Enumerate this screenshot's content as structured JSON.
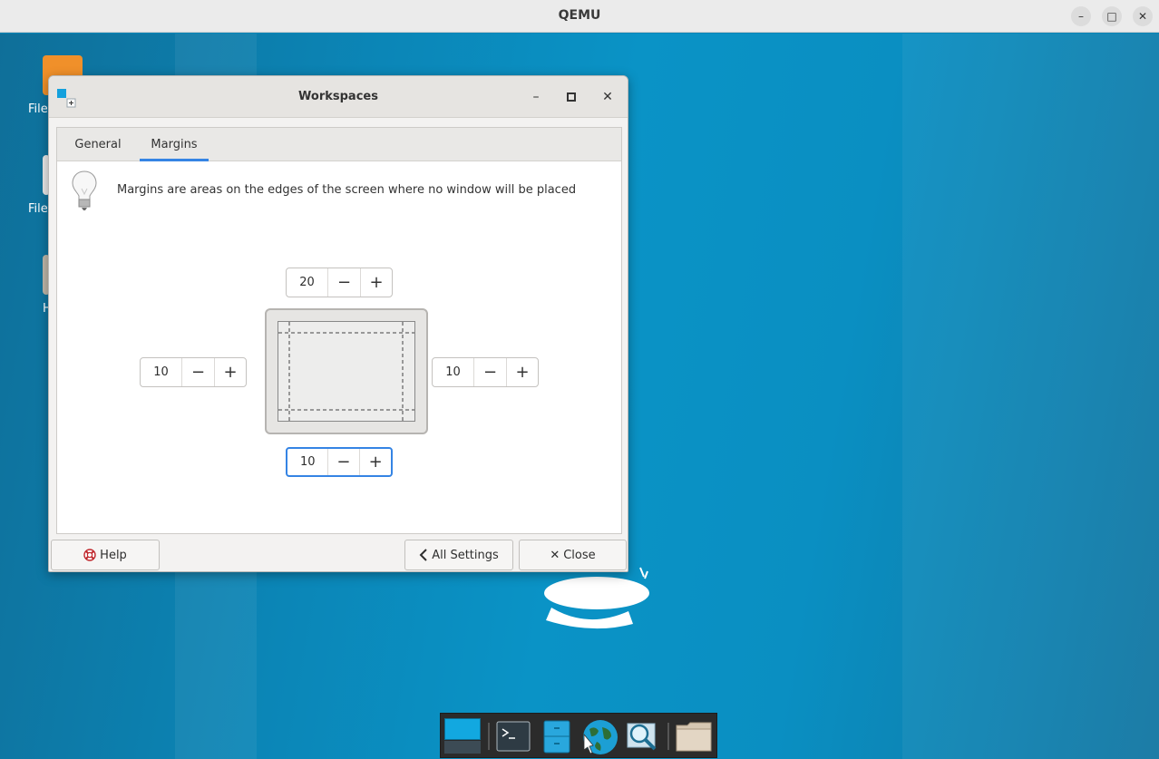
{
  "host": {
    "title": "QEMU"
  },
  "desktop": {
    "icon_labels": [
      "File",
      "File",
      "H"
    ]
  },
  "dialog": {
    "title": "Workspaces",
    "tabs": [
      {
        "label": "General"
      },
      {
        "label": "Margins"
      }
    ],
    "active_tab": "Margins",
    "hint": "Margins are areas on the edges of the screen where no window will be placed",
    "margins": {
      "top": "20",
      "left": "10",
      "right": "10",
      "bottom": "10"
    },
    "buttons": {
      "help": "Help",
      "all_settings": "All Settings",
      "close": "Close"
    }
  },
  "icons": {
    "minimize": "minimize-icon",
    "maximize": "maximize-icon",
    "close": "close-icon",
    "lightbulb": "lightbulb-icon",
    "help": "lifebuoy-icon",
    "back": "chevron-left-icon"
  },
  "colors": {
    "accent": "#3584e4",
    "desktop": "#0a93c6",
    "dock": "#2b2b2b"
  }
}
